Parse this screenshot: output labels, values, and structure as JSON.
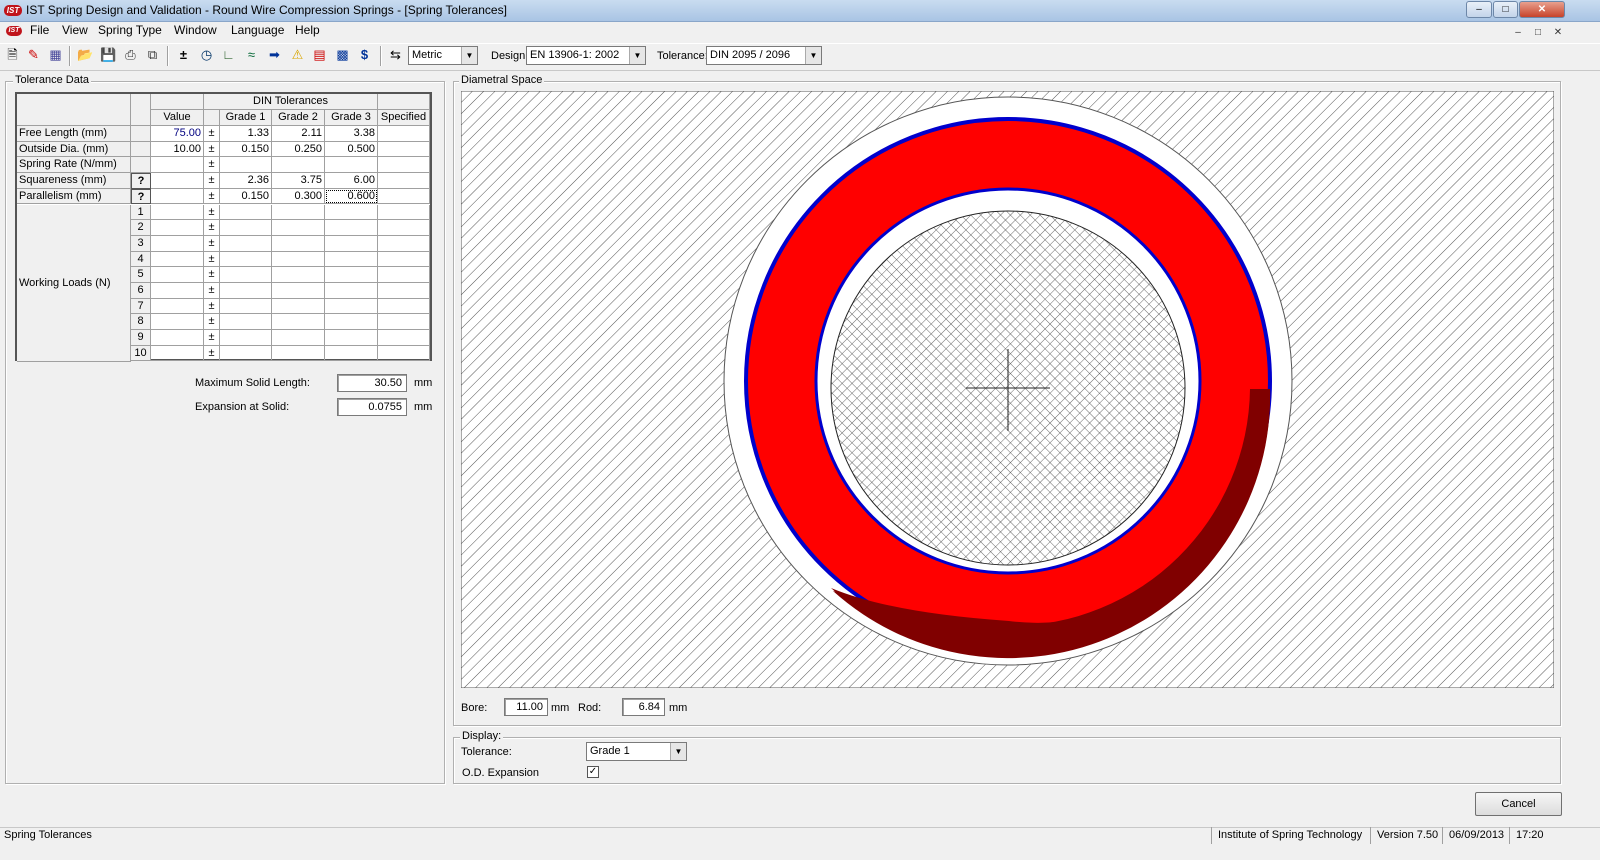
{
  "window": {
    "logo_text": "IST",
    "title": "IST Spring Design and Validation - Round Wire Compression Springs - [Spring Tolerances]",
    "controls": [
      "–",
      "□",
      "✕"
    ]
  },
  "menu": {
    "items": [
      "File",
      "View",
      "Spring Type",
      "Window",
      "Language",
      "Help"
    ],
    "mdi_controls": [
      "–",
      "□",
      "✕"
    ]
  },
  "toolbar": {
    "icons": [
      "new-icon",
      "edit-icon",
      "calculator-icon",
      "open-folder-icon",
      "save-icon",
      "print-icon",
      "copy-icon",
      "tolerance-icon",
      "clock-icon",
      "graph-icon",
      "chart-icon",
      "arrow-icon",
      "warning-icon",
      "histogram-icon",
      "bar-chart-icon",
      "dollar-icon",
      "units-icon"
    ],
    "units_value": "Metric",
    "design_label": "Design:",
    "design_value": "EN 13906-1: 2002",
    "tolerance_label": "Tolerance:",
    "tolerance_value": "DIN 2095 / 2096"
  },
  "tolerance_data": {
    "title": "Tolerance Data",
    "group_header": "DIN Tolerances",
    "columns": [
      "Value",
      "Grade 1",
      "Grade 2",
      "Grade 3",
      "Specified"
    ],
    "rows": [
      {
        "label": "Free Length (mm)",
        "q": "",
        "value": "75.00",
        "pm": "±",
        "g1": "1.33",
        "g2": "2.11",
        "g3": "3.38",
        "spec": ""
      },
      {
        "label": "Outside Dia. (mm)",
        "q": "",
        "value": "10.00",
        "pm": "±",
        "g1": "0.150",
        "g2": "0.250",
        "g3": "0.500",
        "spec": ""
      },
      {
        "label": "Spring Rate (N/mm)",
        "q": "",
        "value": "",
        "pm": "±",
        "g1": "",
        "g2": "",
        "g3": "",
        "spec": ""
      },
      {
        "label": "Squareness (mm)",
        "q": "?",
        "value": "",
        "pm": "±",
        "g1": "2.36",
        "g2": "3.75",
        "g3": "6.00",
        "spec": ""
      },
      {
        "label": "Parallelism (mm)",
        "q": "?",
        "value": "",
        "pm": "±",
        "g1": "0.150",
        "g2": "0.300",
        "g3": "0.600",
        "spec": ""
      }
    ],
    "working_loads_label": "Working Loads (N)",
    "load_rows": [
      "1",
      "2",
      "3",
      "4",
      "5",
      "6",
      "7",
      "8",
      "9",
      "10"
    ],
    "load_pm": "±",
    "max_solid_label": "Maximum Solid Length:",
    "max_solid_value": "30.50",
    "max_solid_unit": "mm",
    "expansion_label": "Expansion at Solid:",
    "expansion_value": "0.0755",
    "expansion_unit": "mm"
  },
  "diametral_space": {
    "title": "Diametral Space",
    "bore_label": "Bore:",
    "bore_value": "11.00",
    "bore_unit": "mm",
    "rod_label": "Rod:",
    "rod_value": "6.84",
    "rod_unit": "mm",
    "colors": {
      "coil": "#ff0000",
      "coil_shadow": "#800000",
      "outline": "#0000cc",
      "hatch": "#555555"
    }
  },
  "display": {
    "title": "Display:",
    "tolerance_label": "Tolerance:",
    "tolerance_value": "Grade 1",
    "od_expansion_label": "O.D. Expansion",
    "od_expansion_checked": "✓"
  },
  "actions": {
    "cancel_label": "Cancel"
  },
  "status": {
    "left": "Spring Tolerances",
    "org": "Institute of Spring Technology",
    "version": "Version 7.50",
    "date": "06/09/2013",
    "time": "17:20"
  }
}
